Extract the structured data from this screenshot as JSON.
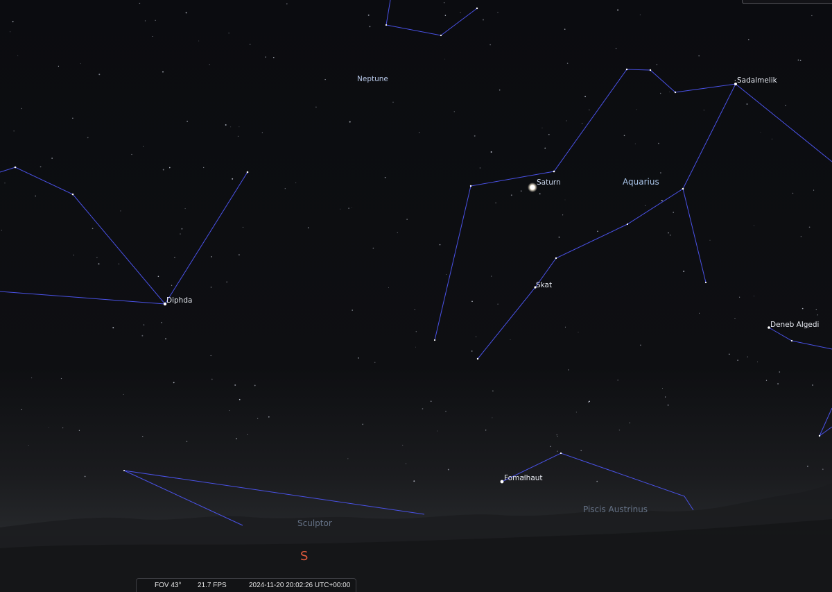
{
  "labels": {
    "neptune": "Neptune",
    "saturn": "Saturn",
    "aquarius": "Aquarius",
    "sadalmelik": "Sadalmelik",
    "diphda": "Diphda",
    "skat": "Skat",
    "deneb_algedi": "Deneb Algedi",
    "fomalhaut": "Fomalhaut",
    "piscis_austrinus": "Piscis Austrinus",
    "sculptor": "Sculptor",
    "cardinal_south": "S"
  },
  "status": {
    "fov": "FOV 43°",
    "fps": "21.7 FPS",
    "datetime": "2024-11-20 20:02:26 UTC+00:00"
  },
  "colors": {
    "sky_top": "#0b0c10",
    "horizon": "#2a2c30",
    "constellation_line": "#4a52e8",
    "cardinal": "#e05a3c"
  }
}
